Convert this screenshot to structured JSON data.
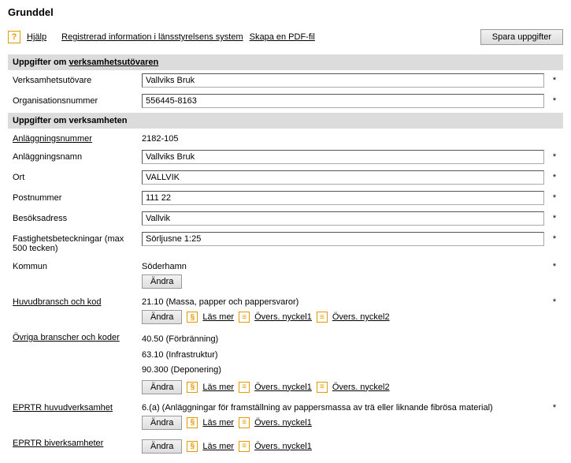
{
  "page_title": "Grunddel",
  "toolbar": {
    "help": "Hjälp",
    "reg_info": "Registrerad information i länsstyrelsens system",
    "create_pdf": "Skapa en PDF-fil",
    "save": "Spara uppgifter"
  },
  "section1": {
    "header_prefix": "Uppgifter om ",
    "header_link": "verksamhetsutövaren",
    "operator_label": "Verksamhetsutövare",
    "operator_value": "Vallviks Bruk",
    "orgnr_label": "Organisationsnummer",
    "orgnr_value": "556445-8163"
  },
  "section2": {
    "header": "Uppgifter om verksamheten",
    "facility_no_label": "Anläggningsnummer",
    "facility_no_value": "2182-105",
    "facility_name_label": "Anläggningsnamn",
    "facility_name_value": "Vallviks Bruk",
    "ort_label": "Ort",
    "ort_value": "VALLVIK",
    "postnr_label": "Postnummer",
    "postnr_value": "111 22",
    "besok_label": "Besöksadress",
    "besok_value": "Vallvik",
    "fastighet_label": "Fastighetsbeteckningar (max 500 tecken)",
    "fastighet_value": "Sörljusne 1:25",
    "kommun_label": "Kommun",
    "kommun_value": "Söderhamn"
  },
  "huvudbransch": {
    "label": "Huvudbransch och kod",
    "value": "21.10 (Massa, papper och pappersvaror)"
  },
  "ovriga": {
    "label": "Övriga branscher och koder",
    "line1": "40.50 (Förbränning)",
    "line2": "63.10 (Infrastruktur)",
    "line3": "90.300 (Deponering)"
  },
  "eprtr_huvud": {
    "label": "EPRTR huvudverksamhet",
    "value": "6.(a) (Anläggningar för framställning av pappersmassa av trä eller liknande fibrösa material)"
  },
  "eprtr_bi": {
    "label": "EPRTR biverksamheter"
  },
  "buttons": {
    "andra": "Ändra",
    "las_mer": "Läs mer",
    "nyckel1": "Övers. nyckel1",
    "nyckel2": "Övers. nyckel2"
  },
  "asterisk": "*"
}
